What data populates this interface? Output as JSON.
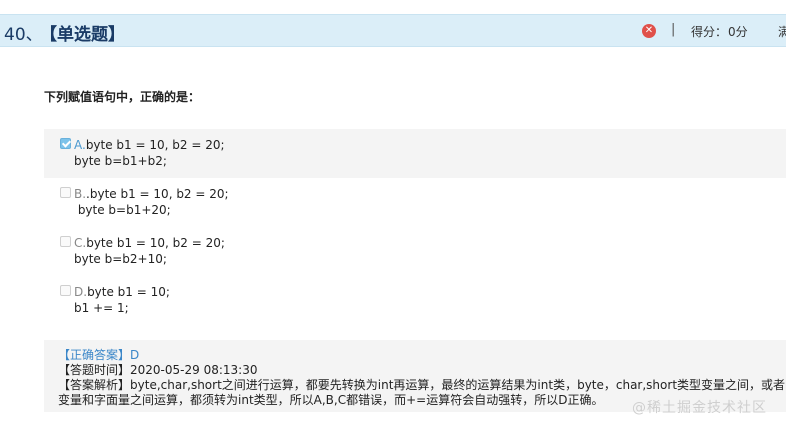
{
  "question": {
    "number": "40、",
    "type": "【单选题】",
    "status_icon": "wrong-x-icon",
    "separator": "|",
    "score_label": "得分：",
    "score_value": "0分",
    "full_label": "满",
    "stem": "下列赋值语句中，正确的是：",
    "colors": {
      "header_bg": "#dbeef8",
      "header_text": "#1a3b66",
      "wrong": "#e0504a",
      "selected": "#4a98cf"
    }
  },
  "options": [
    {
      "letter": "A.",
      "line1": "byte b1 = 10, b2 = 20;",
      "line2": "byte b=b1+b2;",
      "checked": true
    },
    {
      "letter": "B.",
      "line1": ".byte b1 = 10, b2 = 20;",
      "line2": " byte b=b1+20;",
      "checked": false
    },
    {
      "letter": "C.",
      "line1": "byte b1 = 10, b2 = 20;",
      "line2": "byte b=b2+10;",
      "checked": false
    },
    {
      "letter": "D.",
      "line1": "byte b1 = 10;",
      "line2": "b1 += 1;",
      "checked": false
    }
  ],
  "answer": {
    "correct_label": "【正确答案】",
    "correct_value": "D",
    "time_label": "【答题时间】",
    "time_value": "2020-05-29 08:13:30",
    "explanation_label": "【答案解析】",
    "explanation_line1": "byte,char,short之间进行运算，都要先转换为int再运算，最终的运算结果为int类，byte，char,short类型变量之间，或者",
    "explanation_line2": "变量和字面量之间运算，都须转为int类型，所以A,B,C都错误，而+=运算符会自动强转，所以D正确。"
  },
  "watermark": "@稀土掘金技术社区"
}
